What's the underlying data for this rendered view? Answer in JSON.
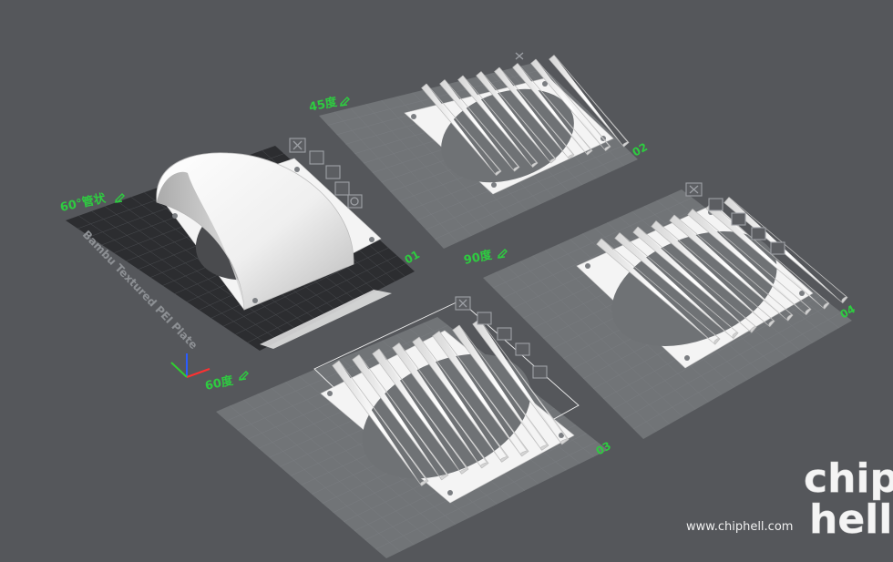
{
  "plates": [
    {
      "id": "01",
      "label": "60°管状",
      "number": "01",
      "plate_name": "Bambu Textured PEI Plate",
      "selected": true
    },
    {
      "id": "02",
      "label": "45度",
      "number": "02",
      "selected": false
    },
    {
      "id": "03",
      "label": "60度",
      "number": "03",
      "selected": false
    },
    {
      "id": "04",
      "label": "90度",
      "number": "04",
      "selected": false
    }
  ],
  "plate_tools": [
    "close-icon",
    "orient-icon",
    "arrange-icon",
    "lock-icon",
    "settings-icon"
  ],
  "watermark": {
    "url": "www.chiphell.com",
    "logo_line1": "chip",
    "logo_line2": "hell"
  },
  "colors": {
    "background": "#55575b",
    "label_green": "#2ecc40",
    "plate_dark": "#2c2d30",
    "plate_light": "#737679"
  }
}
